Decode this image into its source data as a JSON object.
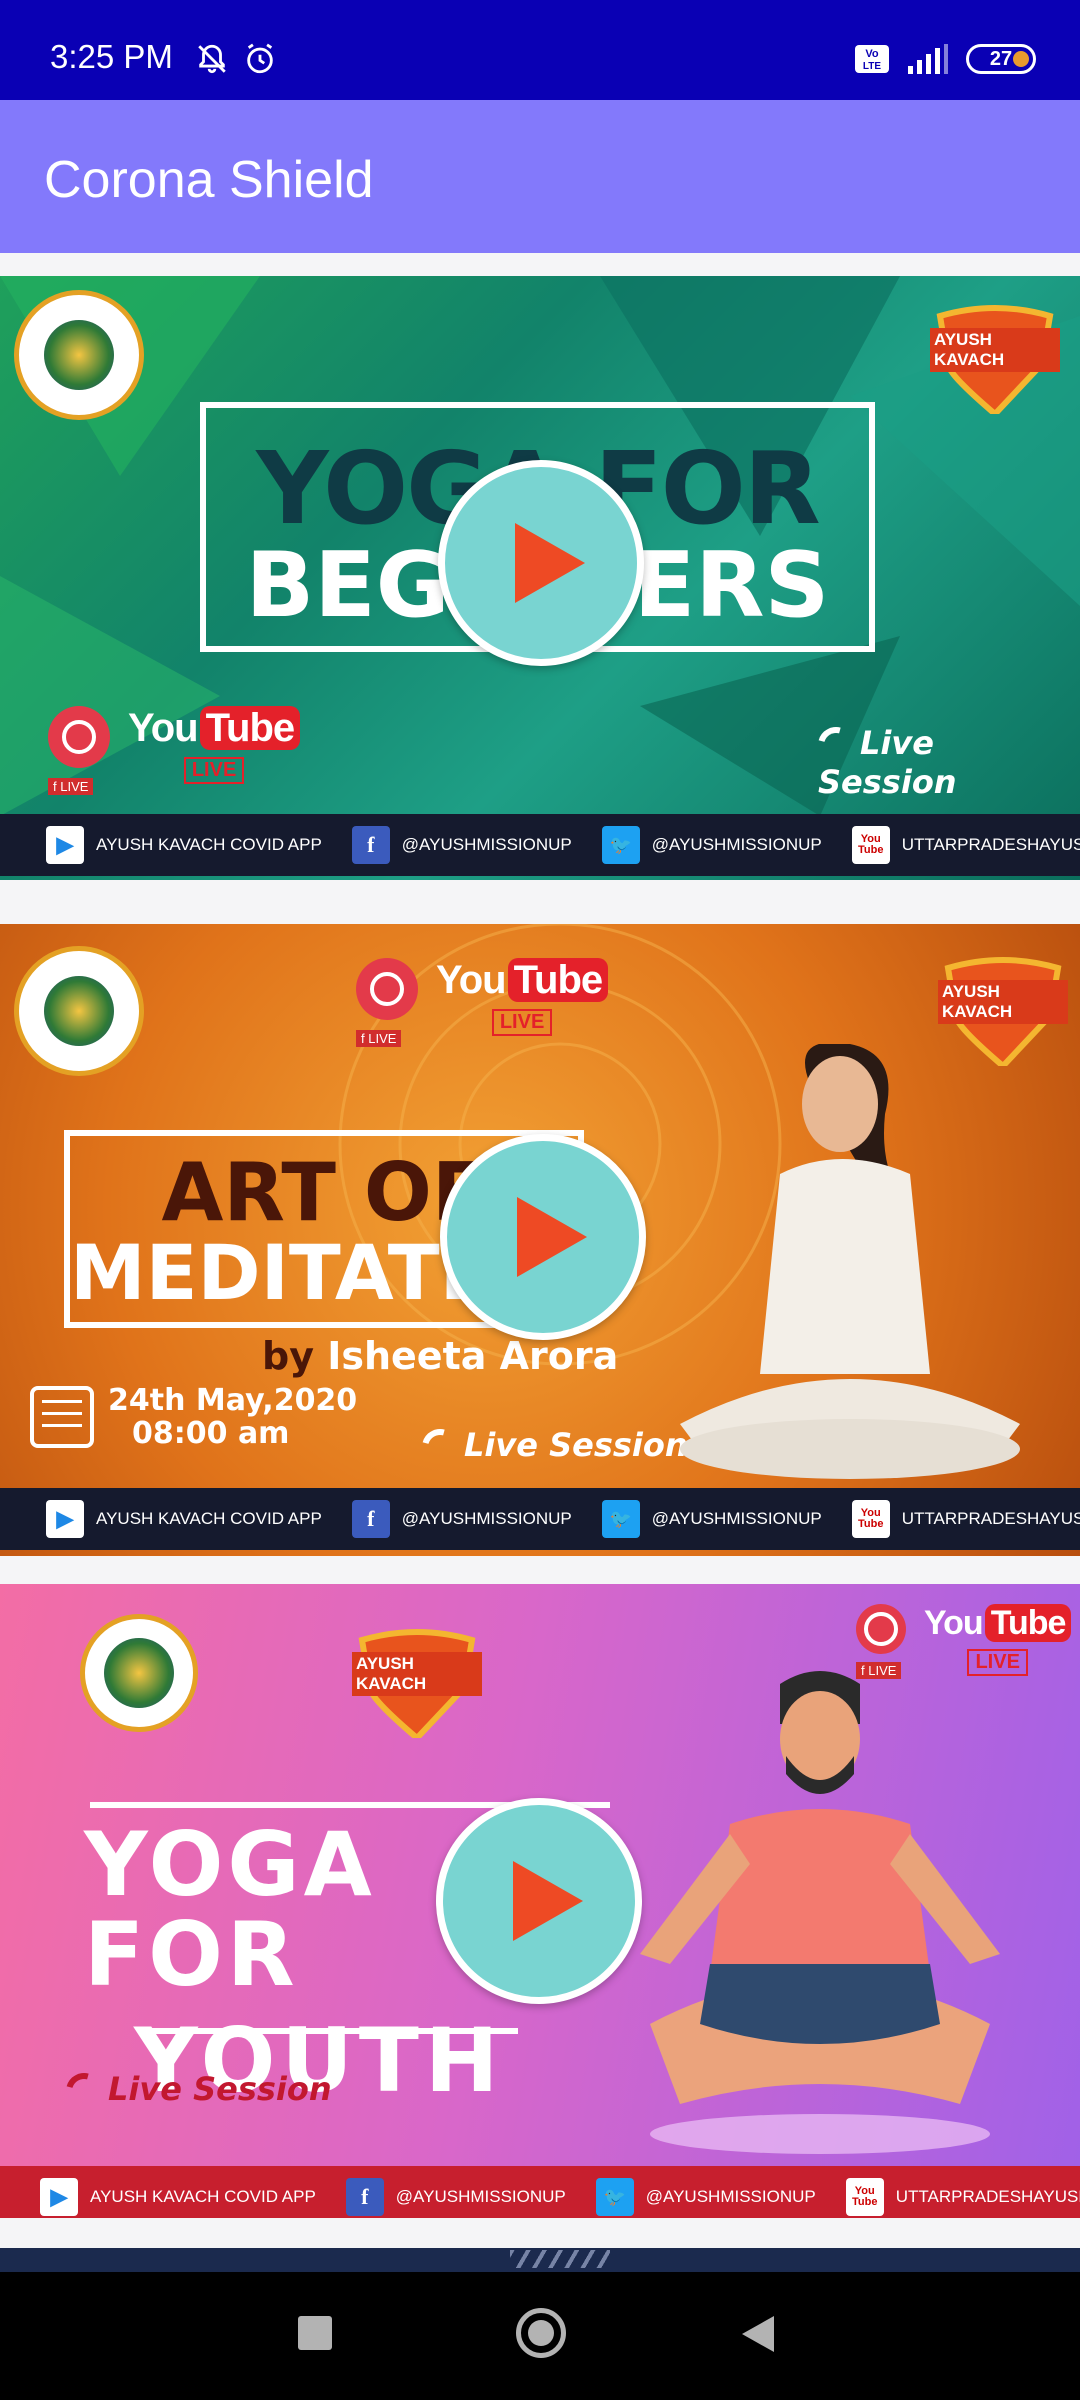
{
  "status_bar": {
    "time": "3:25 PM",
    "battery": "27",
    "network_badge": "Vo LTE",
    "icons_left": [
      "bell-off-icon",
      "alarm-icon"
    ],
    "icons_right": [
      "volte-icon",
      "signal-icon",
      "battery-icon"
    ]
  },
  "app_bar": {
    "title": "Corona Shield"
  },
  "videos": [
    {
      "title_line1": "YOGA FOR",
      "title_line2": "BEGINNERS",
      "live_session": "Live Session",
      "youtube": "You",
      "youtube_tube": "Tube",
      "live_badge": "LIVE",
      "fb_live": "f LIVE",
      "shield_label": "AYUSH KAVACH"
    },
    {
      "title_line1": "ART OF",
      "title_line2": "MEDITATION",
      "by_prefix": "by",
      "presenter": "Isheeta Arora",
      "date": "24th May,2020",
      "time": "08:00 am",
      "live_session": "Live Session",
      "youtube": "You",
      "youtube_tube": "Tube",
      "live_badge": "LIVE",
      "fb_live": "f LIVE",
      "shield_label": "AYUSH KAVACH"
    },
    {
      "title_line1": "YOGA FOR",
      "title_line2": "YOUTH",
      "live_session": "Live Session",
      "youtube": "You",
      "youtube_tube": "Tube",
      "live_badge": "LIVE",
      "fb_live": "f LIVE",
      "shield_label": "AYUSH KAVACH"
    }
  ],
  "footer_strip": {
    "app": "AYUSH KAVACH COVID APP",
    "facebook": "@AYUSHMISSIONUP",
    "twitter": "@AYUSHMISSIONUP",
    "youtube": "UTTARPRADESHAYUSHSOCIETY",
    "youtube_icon_text": "You Tube"
  },
  "colors": {
    "status_bar": "#0a00b4",
    "app_bar": "#8379fb",
    "play_button": "#79d4d1",
    "play_triangle": "#ee4a24"
  }
}
